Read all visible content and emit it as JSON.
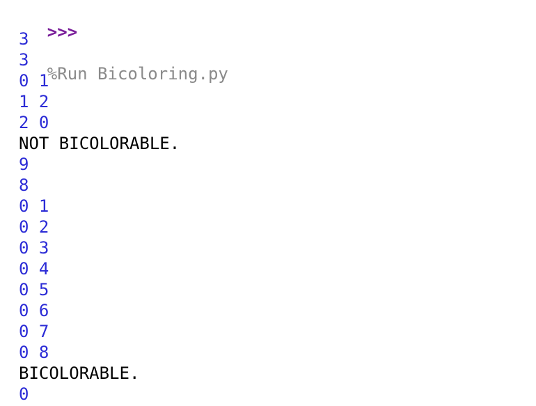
{
  "shell": {
    "prompt": ">>>",
    "command": "%Run Bicoloring.py"
  },
  "output_lines": [
    {
      "kind": "stdin",
      "text": "3"
    },
    {
      "kind": "stdin",
      "text": "3"
    },
    {
      "kind": "stdin",
      "text": "0 1"
    },
    {
      "kind": "stdin",
      "text": "1 2"
    },
    {
      "kind": "stdin",
      "text": "2 0"
    },
    {
      "kind": "stdout",
      "text": "NOT BICOLORABLE."
    },
    {
      "kind": "stdin",
      "text": "9"
    },
    {
      "kind": "stdin",
      "text": "8"
    },
    {
      "kind": "stdin",
      "text": "0 1"
    },
    {
      "kind": "stdin",
      "text": "0 2"
    },
    {
      "kind": "stdin",
      "text": "0 3"
    },
    {
      "kind": "stdin",
      "text": "0 4"
    },
    {
      "kind": "stdin",
      "text": "0 5"
    },
    {
      "kind": "stdin",
      "text": "0 6"
    },
    {
      "kind": "stdin",
      "text": "0 7"
    },
    {
      "kind": "stdin",
      "text": "0 8"
    },
    {
      "kind": "stdout",
      "text": "BICOLORABLE."
    },
    {
      "kind": "stdin",
      "text": "0"
    }
  ],
  "colors": {
    "prompt": "#7a1f9a",
    "command": "#8a8a8a",
    "stdin": "#2b2bd6",
    "stdout": "#000000"
  }
}
